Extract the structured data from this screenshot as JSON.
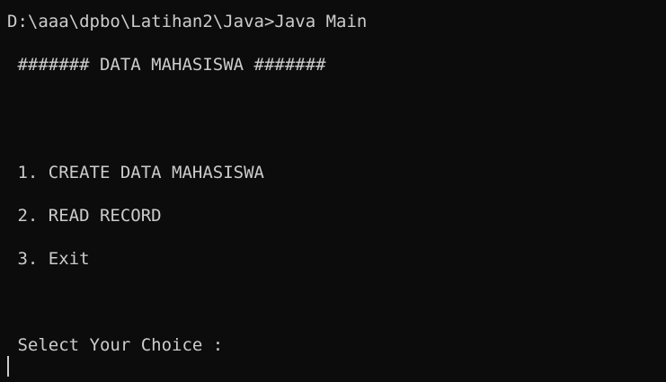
{
  "terminal": {
    "prompt_line": "D:\\aaa\\dpbo\\Latihan2\\Java>Java Main",
    "header": " ####### DATA MAHASISWA #######",
    "menu_items": [
      " 1. CREATE DATA MAHASISWA",
      " 2. READ RECORD",
      " 3. Exit"
    ],
    "choice_prompt": " Select Your Choice :"
  },
  "colors": {
    "background": "#0c0c0c",
    "text": "#cccccc"
  }
}
